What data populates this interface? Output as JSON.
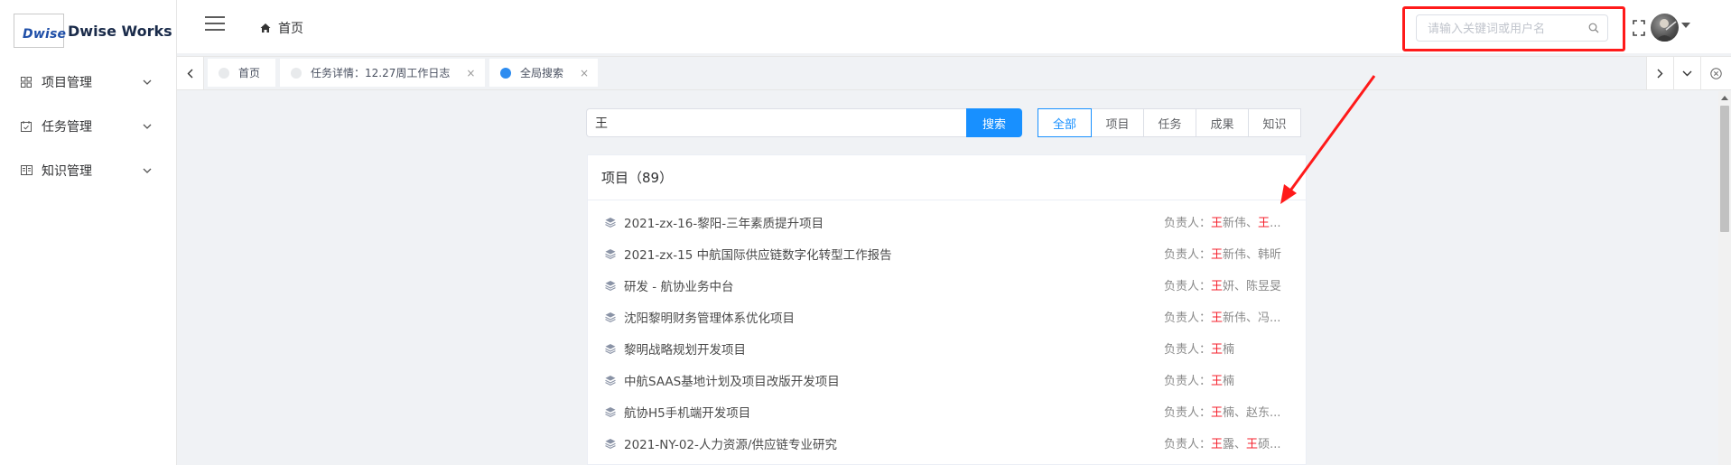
{
  "brand": {
    "logo_mark": "Dwise",
    "name": "Dwise Works"
  },
  "sidebar": {
    "items": [
      {
        "label": "项目管理",
        "icon": "grid-icon"
      },
      {
        "label": "任务管理",
        "icon": "calendar-check-icon"
      },
      {
        "label": "知识管理",
        "icon": "book-icon"
      }
    ]
  },
  "header": {
    "breadcrumb": "首页",
    "search_placeholder": "请输入关键词或用户名"
  },
  "tabs": [
    {
      "label": "首页",
      "active": false,
      "closable": false
    },
    {
      "label": "任务详情：12.27周工作日志",
      "active": false,
      "closable": true
    },
    {
      "label": "全局搜索",
      "active": true,
      "closable": true
    }
  ],
  "tab_close_glyph": "×",
  "main": {
    "query": "王",
    "search_button": "搜索",
    "filters": [
      "全部",
      "项目",
      "任务",
      "成果",
      "知识"
    ],
    "active_filter": "全部",
    "section_title": "项目（89）",
    "lead_prefix": "负责人：",
    "projects": [
      {
        "name": "2021-zx-16-黎阳-三年素质提升项目",
        "lead_hl": "王",
        "lead_rest": "新伟、",
        "lead_hl2": "王",
        "lead_rest2": "...",
        "lead_tail": ""
      },
      {
        "name": "2021-zx-15 中航国际供应链数字化转型工作报告",
        "lead_hl": "王",
        "lead_rest": "新伟、韩昕",
        "lead_hl2": "",
        "lead_rest2": "",
        "lead_tail": ""
      },
      {
        "name": "研发 - 航协业务中台",
        "lead_hl": "王",
        "lead_rest": "妍、陈昱旻",
        "lead_hl2": "",
        "lead_rest2": "",
        "lead_tail": ""
      },
      {
        "name": "沈阳黎明财务管理体系优化项目",
        "lead_hl": "王",
        "lead_rest": "新伟、冯...",
        "lead_hl2": "",
        "lead_rest2": "",
        "lead_tail": ""
      },
      {
        "name": "黎明战略规划开发项目",
        "lead_hl": "王",
        "lead_rest": "楠",
        "lead_hl2": "",
        "lead_rest2": "",
        "lead_tail": ""
      },
      {
        "name": "中航SAAS基地计划及项目改版开发项目",
        "lead_hl": "王",
        "lead_rest": "楠",
        "lead_hl2": "",
        "lead_rest2": "",
        "lead_tail": ""
      },
      {
        "name": "航协H5手机端开发项目",
        "lead_hl": "王",
        "lead_rest": "楠、赵东...",
        "lead_hl2": "",
        "lead_rest2": "",
        "lead_tail": ""
      },
      {
        "name": "2021-NY-02-人力资源/供应链专业研究",
        "lead_hl": "王",
        "lead_rest": "露、",
        "lead_hl2": "王",
        "lead_rest2": "硕...",
        "lead_tail": ""
      }
    ]
  },
  "colors": {
    "accent": "#1890ff",
    "highlight": "#f5222d",
    "annotation": "#ff1a1a"
  }
}
